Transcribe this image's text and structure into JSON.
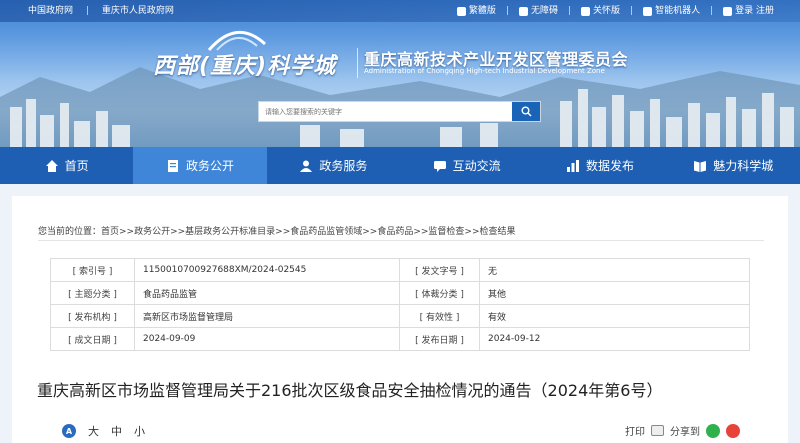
{
  "topbar": {
    "links": [
      "中国政府网",
      "重庆市人民政府网"
    ],
    "tools": [
      "繁體版",
      "无障碍",
      "关怀版",
      "智能机器人",
      "登录 注册"
    ]
  },
  "header": {
    "brand": "西部(重庆)科学城",
    "org_cn": "重庆高新技术产业开发区管理委员会",
    "org_en": "Administration of Chongqing High-tech Industrial Development Zone"
  },
  "search": {
    "placeholder": "请输入您要搜索的关键字"
  },
  "nav": [
    {
      "label": "首页",
      "icon": "home-icon"
    },
    {
      "label": "政务公开",
      "icon": "document-icon"
    },
    {
      "label": "政务服务",
      "icon": "user-icon"
    },
    {
      "label": "互动交流",
      "icon": "chat-icon"
    },
    {
      "label": "数据发布",
      "icon": "chart-icon"
    },
    {
      "label": "魅力科学城",
      "icon": "book-icon"
    }
  ],
  "breadcrumb": "您当前的位置：首页>>政务公开>>基层政务公开标准目录>>食品药品监管领域>>食品药品>>监督检查>>检查结果",
  "meta": [
    {
      "k1": "[ 索引号 ]",
      "v1": "11500107009276 88XM/2024-02545",
      "k2": "[ 发文字号 ]",
      "v2": "无"
    },
    {
      "k1": "[ 主题分类 ]",
      "v1": "食品药品监管",
      "k2": "[ 体裁分类 ]",
      "v2": "其他"
    },
    {
      "k1": "[ 发布机构 ]",
      "v1": "高新区市场监督管理局",
      "k2": "[ 有效性 ]",
      "v2": "有效"
    },
    {
      "k1": "[ 成文日期 ]",
      "v1": "2024-09-09",
      "k2": "[ 发布日期 ]",
      "v2": "2024-09-12"
    }
  ],
  "article_title": "重庆高新区市场监督管理局关于216批次区级食品安全抽检情况的通告（2024年第6号）",
  "font_tools": {
    "large": "大",
    "medium": "中",
    "small": "小"
  },
  "share": {
    "print": "打印",
    "share_to": "分享到"
  }
}
